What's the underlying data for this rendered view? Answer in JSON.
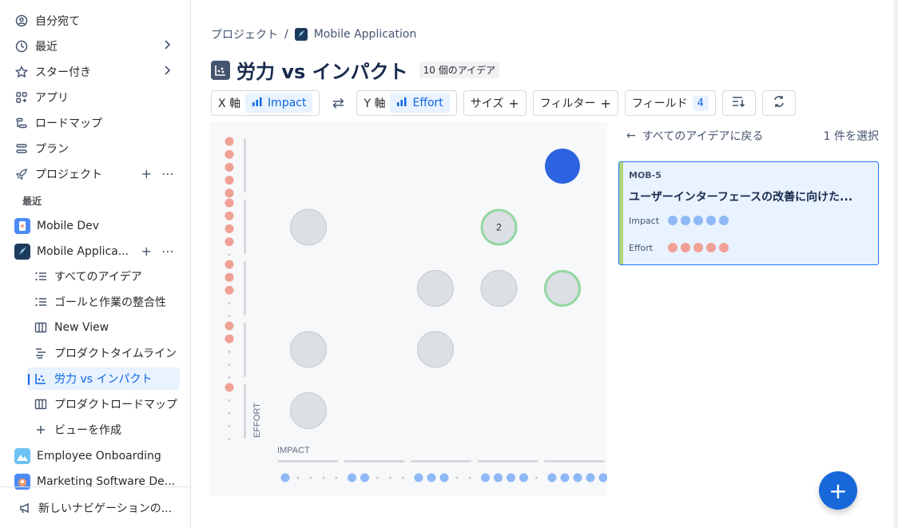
{
  "sidebar": {
    "top_items": [
      {
        "label": "自分宛て",
        "icon": "person-circle-icon"
      },
      {
        "label": "最近",
        "icon": "clock-icon"
      },
      {
        "label": "スター付き",
        "icon": "star-icon"
      },
      {
        "label": "アプリ",
        "icon": "apps-icon"
      },
      {
        "label": "ロードマップ",
        "icon": "roadmap-icon"
      },
      {
        "label": "プラン",
        "icon": "plan-icon"
      },
      {
        "label": "プロジェクト",
        "icon": "rocket-icon"
      }
    ],
    "recent_header": "最近",
    "projects": [
      {
        "label": "Mobile Dev"
      },
      {
        "label": "Mobile Applica..."
      }
    ],
    "views": [
      {
        "label": "すべてのアイデア",
        "icon": "list-icon"
      },
      {
        "label": "ゴールと作業の整合性",
        "icon": "list-icon"
      },
      {
        "label": "New View",
        "icon": "board-icon"
      },
      {
        "label": "プロダクトタイムライン",
        "icon": "timeline-icon"
      },
      {
        "label": "労力 vs インパクト",
        "icon": "matrix-icon"
      },
      {
        "label": "プロダクトロードマップ",
        "icon": "board-icon"
      },
      {
        "label": "ビューを作成",
        "icon": "plus-icon"
      }
    ],
    "more_projects": [
      {
        "label": "Employee Onboarding"
      },
      {
        "label": "Marketing Software De..."
      }
    ],
    "footer": "新しいナビゲーションの..."
  },
  "breadcrumb": {
    "root": "プロジェクト",
    "separator": "/",
    "project": "Mobile Application"
  },
  "page": {
    "title": "労力 vs インパクト",
    "badge": "10 個のアイデア"
  },
  "toolbar": {
    "x_axis_label": "X 軸",
    "x_field": "Impact",
    "y_axis_label": "Y 軸",
    "y_field": "Effort",
    "size_label": "サイズ",
    "filter_label": "フィルター",
    "fields_label": "フィールド",
    "fields_count": "4"
  },
  "matrix": {
    "x_axis_label": "IMPACT",
    "y_axis_label": "EFFORT",
    "group_count_label": "2",
    "colors": {
      "impact": "#8fb8f6",
      "effort": "#f0a095",
      "selected": "#2d63e0",
      "bubble": "#dcdfe4",
      "highlight": "#94d7a2"
    }
  },
  "chart_data": {
    "type": "scatter",
    "xlabel": "IMPACT",
    "ylabel": "EFFORT",
    "xlim": [
      1,
      5
    ],
    "ylim": [
      1,
      5
    ],
    "points": [
      {
        "x": 5,
        "y": 5,
        "count": 1,
        "state": "selected"
      },
      {
        "x": 1,
        "y": 4,
        "count": 1,
        "state": "normal"
      },
      {
        "x": 4,
        "y": 4,
        "count": 2,
        "state": "highlight"
      },
      {
        "x": 3,
        "y": 3,
        "count": 1,
        "state": "normal"
      },
      {
        "x": 4,
        "y": 3,
        "count": 1,
        "state": "normal"
      },
      {
        "x": 5,
        "y": 3,
        "count": 1,
        "state": "highlight"
      },
      {
        "x": 1,
        "y": 2,
        "count": 1,
        "state": "normal"
      },
      {
        "x": 3,
        "y": 2,
        "count": 1,
        "state": "normal"
      },
      {
        "x": 1,
        "y": 1,
        "count": 1,
        "state": "normal"
      }
    ]
  },
  "panel": {
    "back_label": "すべてのアイデアに戻る",
    "selected_count": "1 件を選択",
    "card": {
      "key": "MOB-5",
      "title": "ユーザーインターフェースの改善に向けた...",
      "impact_label": "Impact",
      "impact_value": 5,
      "effort_label": "Effort",
      "effort_value": 5
    }
  }
}
